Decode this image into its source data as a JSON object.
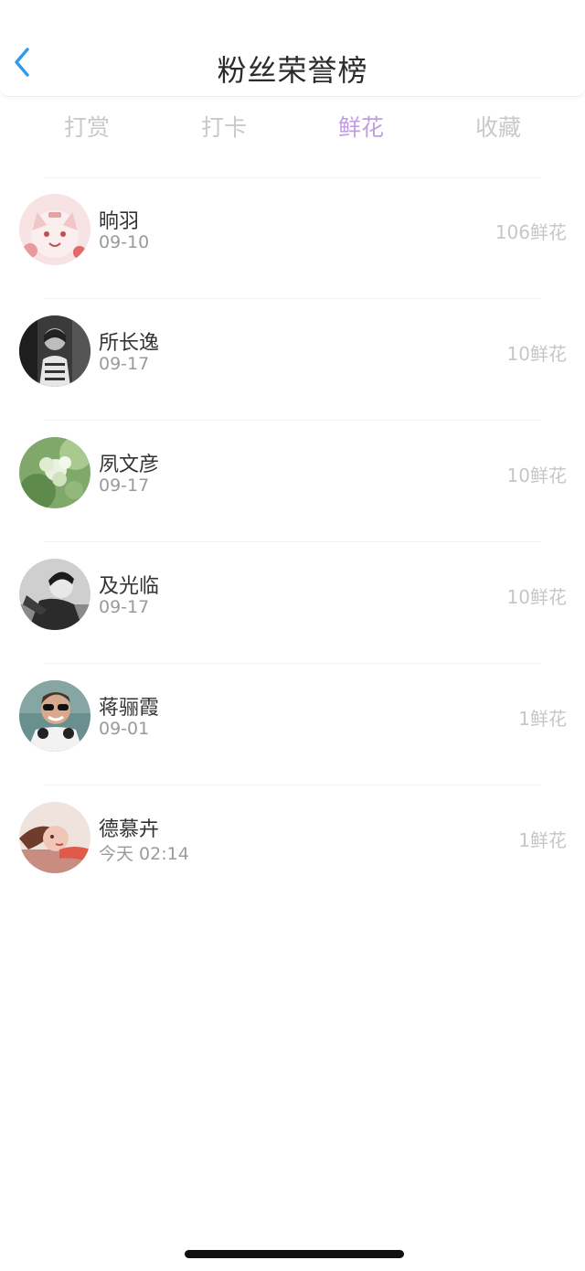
{
  "nav": {
    "title": "粉丝荣誉榜",
    "back_icon": "chevron-left-icon",
    "back_color": "#2f9be9"
  },
  "tabs": [
    {
      "label": "打赏",
      "active": false
    },
    {
      "label": "打卡",
      "active": false
    },
    {
      "label": "鲜花",
      "active": true
    },
    {
      "label": "收藏",
      "active": false
    }
  ],
  "colors": {
    "active_tab": "#c29ce2",
    "inactive_tab": "#c9c9c9"
  },
  "fans": [
    {
      "name": "晌羽",
      "date": "09-10",
      "count": "106鲜花",
      "avatar": "cartoon-cat-avatar"
    },
    {
      "name": "所长逸",
      "date": "09-17",
      "count": "10鲜花",
      "avatar": "bw-portrait-avatar"
    },
    {
      "name": "夙文彦",
      "date": "09-17",
      "count": "10鲜花",
      "avatar": "green-flower-avatar"
    },
    {
      "name": "及光临",
      "date": "09-17",
      "count": "10鲜花",
      "avatar": "bw-man-avatar"
    },
    {
      "name": "蒋骊霞",
      "date": "09-01",
      "count": "1鲜花",
      "avatar": "man-sunglasses-avatar"
    },
    {
      "name": "德慕卉",
      "date": "今天 02:14",
      "count": "1鲜花",
      "avatar": "woman-lying-avatar"
    }
  ]
}
